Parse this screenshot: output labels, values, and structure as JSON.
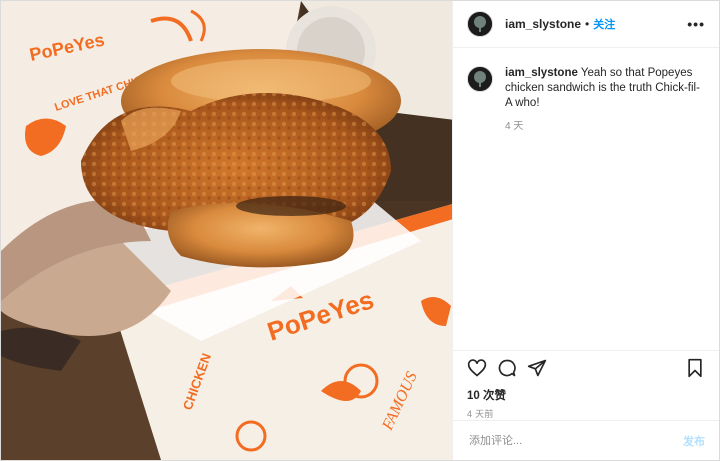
{
  "post": {
    "username": "iam_slystone",
    "separator": "•",
    "follow_label": "关注",
    "more_label": "•••"
  },
  "caption": {
    "username": "iam_slystone",
    "text": "Yeah so that Popeyes chicken sandwich is the truth Chick-fil-A who!",
    "time": "4 天"
  },
  "engagement": {
    "likes": "10 次赞",
    "date": "4 天前"
  },
  "comment_box": {
    "placeholder": "添加评论...",
    "post_label": "发布"
  },
  "photo": {
    "wrapper_brand": "PoPeYes",
    "wrapper_tagline": "LOVE THAT CHICKEN",
    "wrapper_word": "CHICKEN",
    "wrapper_sub": "FAMOUS",
    "accent_color": "#f26c22",
    "bun_color": "#d98a3d"
  },
  "icons": {
    "like": "heart-icon",
    "comment": "comment-icon",
    "share": "share-icon",
    "save": "bookmark-icon"
  }
}
